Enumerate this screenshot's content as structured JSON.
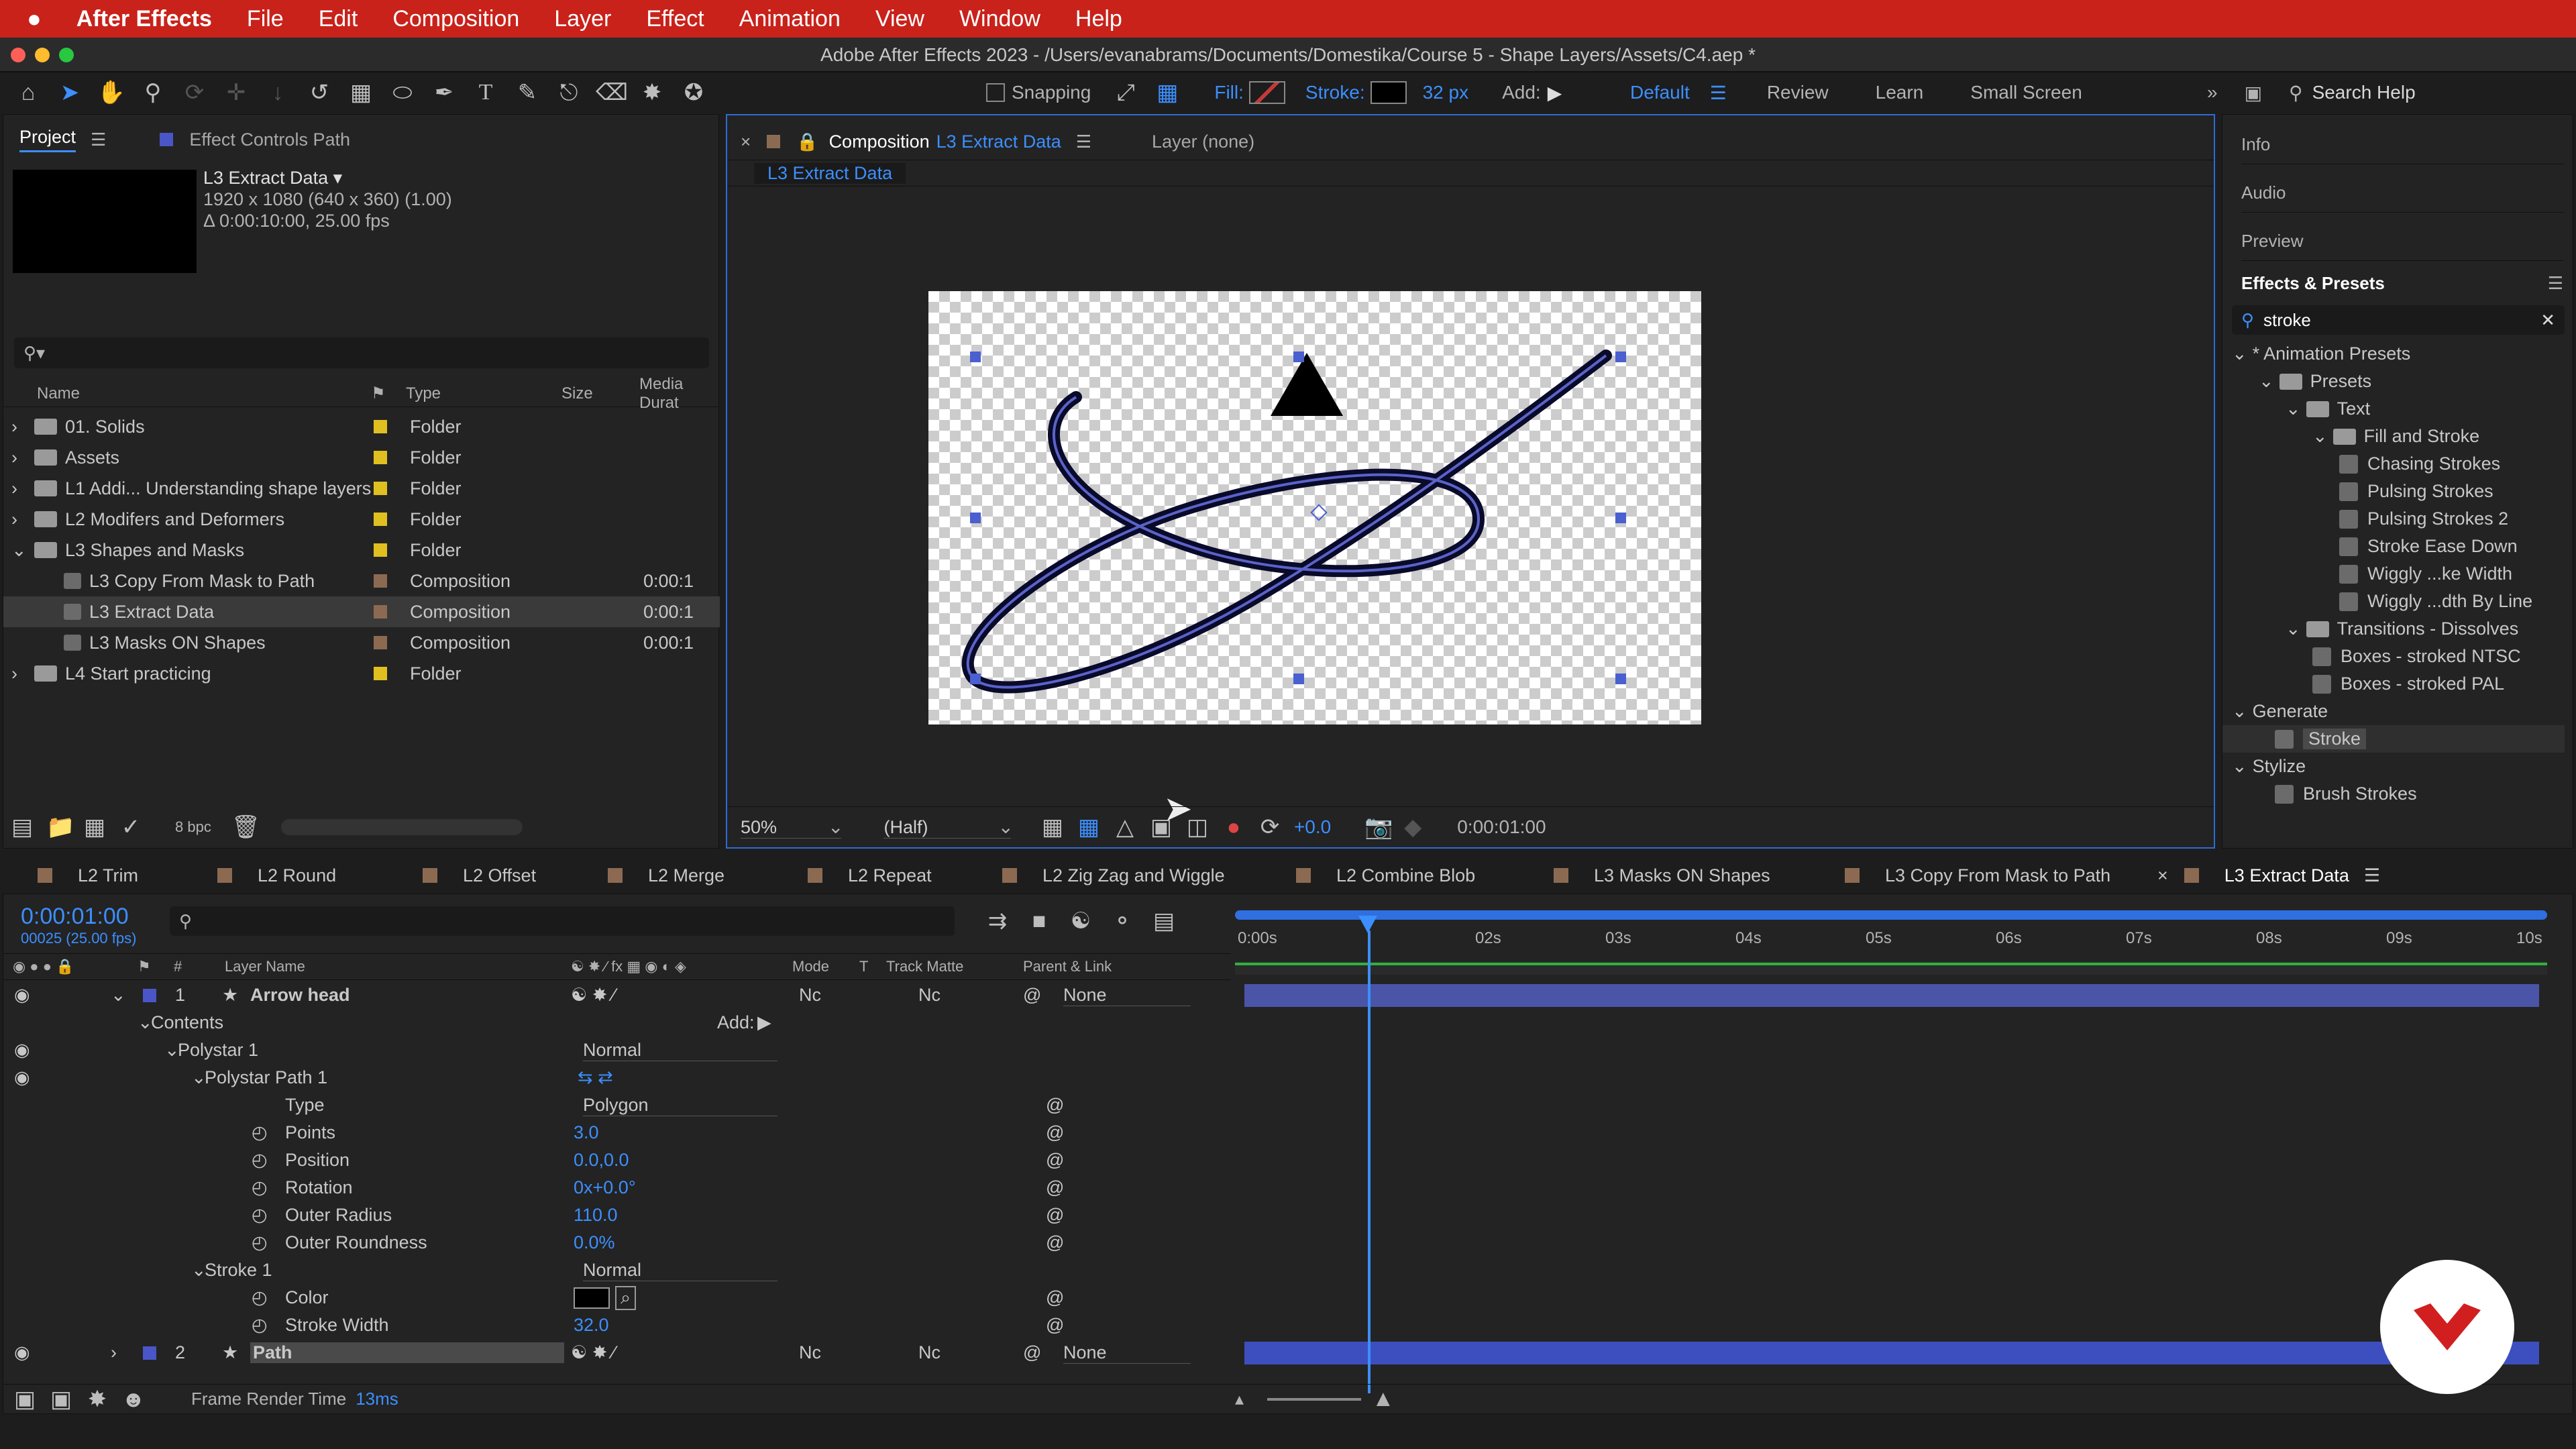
{
  "menubar": {
    "app": "After Effects",
    "items": [
      "File",
      "Edit",
      "Composition",
      "Layer",
      "Effect",
      "Animation",
      "View",
      "Window",
      "Help"
    ]
  },
  "window": {
    "title": "Adobe After Effects 2023 - /Users/evanabrams/Documents/Domestika/Course 5 - Shape Layers/Assets/C4.aep *"
  },
  "toolbar": {
    "snapping": "Snapping",
    "fill_label": "Fill:",
    "stroke_label": "Stroke:",
    "stroke_width": "32 px",
    "add_label": "Add:",
    "workspaces": [
      "Default",
      "Review",
      "Learn",
      "Small Screen"
    ],
    "search_placeholder": "Search Help",
    "colors": {
      "accent": "#3c8fff",
      "menubar": "#c8221a",
      "fill_swatch": "#c43a3a"
    }
  },
  "project": {
    "tab": "Project",
    "effect_controls_tab": "Effect Controls Path",
    "comp_name": "L3 Extract Data ▾",
    "comp_info1": "1920 x 1080  (640 x 360) (1.00)",
    "comp_info2": "Δ 0:00:10:00, 25.00 fps",
    "columns": [
      "Name",
      "Type",
      "Size",
      "Media Durat"
    ],
    "items": [
      {
        "name": "01. Solids",
        "type": "Folder",
        "dur": "",
        "indent": 0,
        "kind": "folder",
        "color": "#e0c020"
      },
      {
        "name": "Assets",
        "type": "Folder",
        "dur": "",
        "indent": 0,
        "kind": "folder",
        "color": "#e0c020"
      },
      {
        "name": "L1 Addi... Understanding shape layers",
        "type": "Folder",
        "dur": "",
        "indent": 0,
        "kind": "folder",
        "color": "#e0c020"
      },
      {
        "name": "L2 Modifers and Deformers",
        "type": "Folder",
        "dur": "",
        "indent": 0,
        "kind": "folder",
        "color": "#e0c020"
      },
      {
        "name": "L3 Shapes and Masks",
        "type": "Folder",
        "dur": "",
        "indent": 0,
        "kind": "folder",
        "color": "#e0c020",
        "open": true
      },
      {
        "name": "L3 Copy From Mask to Path",
        "type": "Composition",
        "dur": "0:00:1",
        "indent": 1,
        "kind": "comp",
        "color": "#8c6a52"
      },
      {
        "name": "L3 Extract Data",
        "type": "Composition",
        "dur": "0:00:1",
        "indent": 1,
        "kind": "comp",
        "color": "#8c6a52",
        "selected": true
      },
      {
        "name": "L3 Masks ON Shapes",
        "type": "Composition",
        "dur": "0:00:1",
        "indent": 1,
        "kind": "comp",
        "color": "#8c6a52"
      },
      {
        "name": "L4 Start practicing",
        "type": "Folder",
        "dur": "",
        "indent": 0,
        "kind": "folder",
        "color": "#e0c020"
      }
    ],
    "bpc": "8 bpc"
  },
  "viewer": {
    "tab_prefix": "Composition",
    "tab_comp": "L3 Extract Data",
    "layer_tab": "Layer (none)",
    "breadcrumb": "L3 Extract Data",
    "zoom": "50%",
    "resolution": "(Half)",
    "exposure": "+0.0",
    "timecode": "0:00:01:00"
  },
  "right": {
    "panels": [
      "Info",
      "Audio",
      "Preview"
    ],
    "effects_title": "Effects & Presets",
    "search_value": "stroke",
    "tree": [
      {
        "label": "* Animation Presets",
        "level": 0,
        "kind": "arrow"
      },
      {
        "label": "Presets",
        "level": 1,
        "kind": "folder"
      },
      {
        "label": "Text",
        "level": 2,
        "kind": "folder"
      },
      {
        "label": "Fill and Stroke",
        "level": 3,
        "kind": "folder"
      },
      {
        "label": "Chasing Strokes",
        "level": 4,
        "kind": "preset"
      },
      {
        "label": "Pulsing Strokes",
        "level": 4,
        "kind": "preset"
      },
      {
        "label": "Pulsing Strokes 2",
        "level": 4,
        "kind": "preset"
      },
      {
        "label": "Stroke Ease Down",
        "level": 4,
        "kind": "preset"
      },
      {
        "label": "Wiggly ...ke Width",
        "level": 4,
        "kind": "preset"
      },
      {
        "label": "Wiggly ...dth By Line",
        "level": 4,
        "kind": "preset"
      },
      {
        "label": "Transitions - Dissolves",
        "level": 2,
        "kind": "folder"
      },
      {
        "label": "Boxes - stroked NTSC",
        "level": 3,
        "kind": "preset"
      },
      {
        "label": "Boxes - stroked PAL",
        "level": 3,
        "kind": "preset"
      },
      {
        "label": "Generate",
        "level": 0,
        "kind": "arrow"
      },
      {
        "label": "Stroke",
        "level": 1,
        "kind": "effect",
        "selected": true
      },
      {
        "label": "Stylize",
        "level": 0,
        "kind": "arrow"
      },
      {
        "label": "Brush Strokes",
        "level": 1,
        "kind": "effect"
      }
    ]
  },
  "timeline": {
    "tabs": [
      {
        "label": "L2 Trim",
        "color": "#8c6a52"
      },
      {
        "label": "L2 Round",
        "color": "#8c6a52"
      },
      {
        "label": "L2 Offset",
        "color": "#8c6a52"
      },
      {
        "label": "L2 Merge",
        "color": "#8c6a52"
      },
      {
        "label": "L2 Repeat",
        "color": "#8c6a52"
      },
      {
        "label": "L2 Zig Zag and Wiggle",
        "color": "#8c6a52"
      },
      {
        "label": "L2 Combine Blob",
        "color": "#8c6a52"
      },
      {
        "label": "L3 Masks ON Shapes",
        "color": "#8c6a52"
      },
      {
        "label": "L3 Copy From Mask to Path",
        "color": "#8c6a52"
      },
      {
        "label": "L3 Extract Data",
        "color": "#8c6a52",
        "active": true
      }
    ],
    "timecode": "0:00:01:00",
    "frames": "00025 (25.00 fps)",
    "columns": {
      "num": "#",
      "layer_name": "Layer Name",
      "mode": "Mode",
      "t": "T",
      "track_matte": "Track Matte",
      "parent": "Parent & Link"
    },
    "ruler": [
      "0:00s",
      "02s",
      "03s",
      "04s",
      "05s",
      "06s",
      "07s",
      "08s",
      "09s",
      "10s"
    ],
    "current_time_fraction": 0.1,
    "rows": [
      {
        "kind": "layer",
        "num": "1",
        "name": "Arrow head",
        "mode": "Nc",
        "matte": "Nc",
        "parent": "None",
        "indent": 0
      },
      {
        "kind": "group",
        "name": "Contents",
        "indent": 1,
        "add": "Add:"
      },
      {
        "kind": "group",
        "name": "Polystar 1",
        "indent": 2,
        "blend": "Normal"
      },
      {
        "kind": "group",
        "name": "Polystar Path 1",
        "indent": 3
      },
      {
        "kind": "prop",
        "name": "Type",
        "indent": 4,
        "dropdown": "Polygon"
      },
      {
        "kind": "prop",
        "name": "Points",
        "indent": 4,
        "value": "3.0",
        "stopwatch": true
      },
      {
        "kind": "prop",
        "name": "Position",
        "indent": 4,
        "value": "0.0,0.0",
        "stopwatch": true
      },
      {
        "kind": "prop",
        "name": "Rotation",
        "indent": 4,
        "value": "0x+0.0°",
        "stopwatch": true
      },
      {
        "kind": "prop",
        "name": "Outer Radius",
        "indent": 4,
        "value": "110.0",
        "stopwatch": true
      },
      {
        "kind": "prop",
        "name": "Outer Roundness",
        "indent": 4,
        "value": "0.0%",
        "stopwatch": true
      },
      {
        "kind": "group",
        "name": "Stroke 1",
        "indent": 3,
        "blend": "Normal"
      },
      {
        "kind": "prop",
        "name": "Color",
        "indent": 4,
        "color": true,
        "stopwatch": true
      },
      {
        "kind": "prop",
        "name": "Stroke Width",
        "indent": 4,
        "value": "32.0",
        "stopwatch": true
      },
      {
        "kind": "layer",
        "num": "2",
        "name": "Path",
        "mode": "Nc",
        "matte": "Nc",
        "parent": "None",
        "indent": 0,
        "selected": true
      }
    ],
    "render_label": "Frame Render Time",
    "render_time": "13ms"
  }
}
